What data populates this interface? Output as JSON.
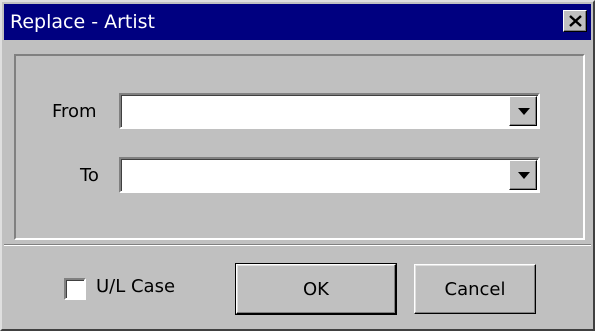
{
  "window": {
    "title": "Replace - Artist"
  },
  "form": {
    "from_label": "From",
    "from_value": "",
    "to_label": "To",
    "to_value": ""
  },
  "options": {
    "case_label": "U/L Case",
    "case_checked": false
  },
  "buttons": {
    "ok_label": "OK",
    "cancel_label": "Cancel"
  },
  "icons": {
    "close": "close-icon",
    "dropdown": "chevron-down-icon"
  },
  "colors": {
    "titlebar": "#000080",
    "face": "#c0c0c0"
  }
}
